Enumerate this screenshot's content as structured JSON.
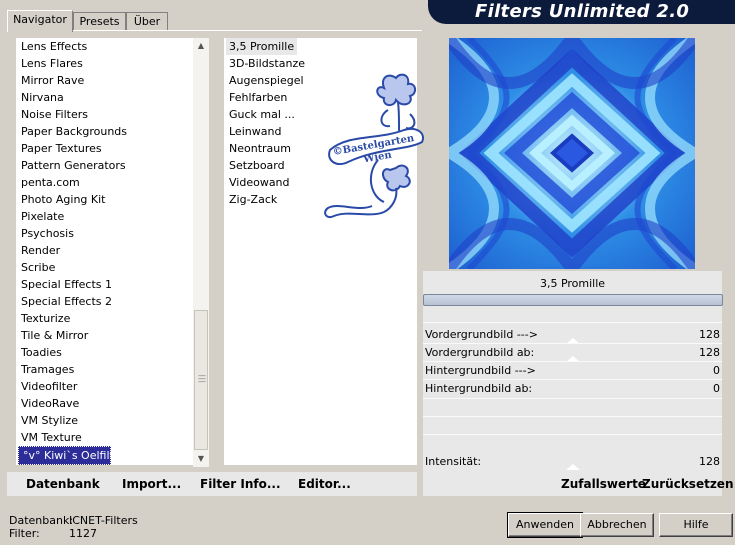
{
  "tabs": [
    {
      "label": "Navigator",
      "active": true
    },
    {
      "label": "Presets",
      "active": false
    },
    {
      "label": "Über",
      "active": false
    }
  ],
  "app_title": "Filters Unlimited 2.0",
  "categories": [
    "Lens Effects",
    "Lens Flares",
    "Mirror Rave",
    "Nirvana",
    "Noise Filters",
    "Paper Backgrounds",
    "Paper Textures",
    "Pattern Generators",
    "penta.com",
    "Photo Aging Kit",
    "Pixelate",
    "Psychosis",
    "Render",
    "Scribe",
    "Special Effects 1",
    "Special Effects 2",
    "Texturize",
    "Tile & Mirror",
    "Toadies",
    "Tramages",
    "Videofilter",
    "VideoRave",
    "VM Stylize",
    "VM Texture",
    "°v° Kiwi`s Oelfilter"
  ],
  "selected_category": "°v° Kiwi`s Oelfilter",
  "filters": [
    "3,5 Promille",
    "3D-Bildstanze",
    "Augenspiegel",
    "Fehlfarben",
    "Guck mal ...",
    "Leinwand",
    "Neontraum",
    "Setzboard",
    "Videowand",
    "Zig-Zack"
  ],
  "selected_filter": "3,5 Promille",
  "watermark": {
    "line1": "©Bastelgarten",
    "line2": "Wien"
  },
  "bottom_links": {
    "database": "Datenbank",
    "import": "Import...",
    "filter_info": "Filter Info...",
    "editor": "Editor..."
  },
  "current_filter_name": "3,5 Promille",
  "params": [
    {
      "label": "Vordergrundbild --->",
      "value": "128"
    },
    {
      "label": "Vordergrundbild ab:",
      "value": "128"
    },
    {
      "label": "Hintergrundbild --->",
      "value": "0"
    },
    {
      "label": "Hintergrundbild ab:",
      "value": "0"
    }
  ],
  "intensity": {
    "label": "Intensität:",
    "value": "128"
  },
  "actions": {
    "random": "Zufallswerte",
    "reset": "Zurücksetzen"
  },
  "status": {
    "db_label": "Datenbank:",
    "db_value": "ICNET-Filters",
    "filter_label": "Filter:",
    "filter_value": "1127"
  },
  "buttons": {
    "apply": "Anwenden",
    "cancel": "Abbrechen",
    "help": "Hilfe"
  },
  "colors": {
    "selection": "#2d2d9a",
    "banner": "#0c1a3c",
    "preview_blue": "#1c6ee0"
  }
}
